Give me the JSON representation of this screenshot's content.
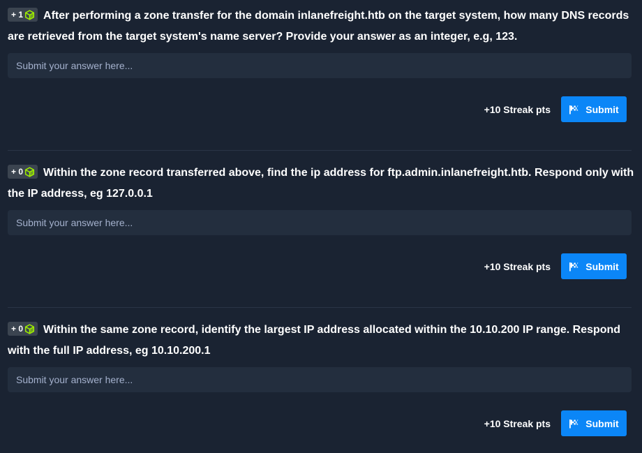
{
  "questions": [
    {
      "points": "+ 1",
      "text": "After performing a zone transfer for the domain inlanefreight.htb on the target system, how many DNS records are retrieved from the target system's name server? Provide your answer as an integer, e.g, 123.",
      "placeholder": "Submit your answer here...",
      "streak": "+10 Streak pts",
      "submit_label": "Submit"
    },
    {
      "points": "+ 0",
      "text": "Within the zone record transferred above, find the ip address for ftp.admin.inlanefreight.htb. Respond only with the IP address, eg 127.0.0.1",
      "placeholder": "Submit your answer here...",
      "streak": "+10 Streak pts",
      "submit_label": "Submit"
    },
    {
      "points": "+ 0",
      "text": "Within the same zone record, identify the largest IP address allocated within the 10.10.200 IP range. Respond with the full IP address, eg 10.10.200.1",
      "placeholder": "Submit your answer here...",
      "streak": "+10 Streak pts",
      "submit_label": "Submit"
    }
  ],
  "icons": {
    "badge": "cube-icon",
    "submit": "flag-icon"
  },
  "colors": {
    "background": "#1a2332",
    "input_background": "#232e3e",
    "badge_background": "#3b4450",
    "cube_green": "#9fef00",
    "submit_blue": "#0b86f7"
  }
}
